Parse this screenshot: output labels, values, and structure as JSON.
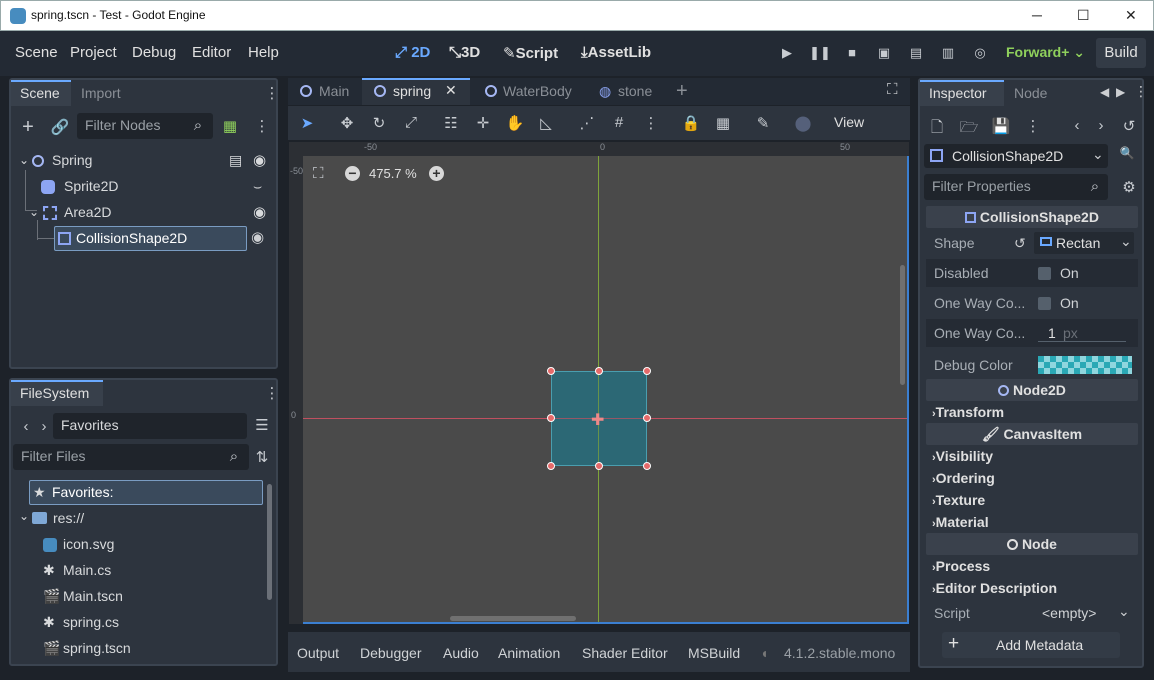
{
  "window": {
    "title": "spring.tscn - Test - Godot Engine",
    "min": "─",
    "max": "☐",
    "close": "✕"
  },
  "menu": [
    "Scene",
    "Project",
    "Debug",
    "Editor",
    "Help"
  ],
  "modes": {
    "m2d": "2D",
    "m3d": "3D",
    "script": "Script",
    "assetlib": "AssetLib"
  },
  "renderer": "Forward+",
  "build": "Build",
  "scene_dock": {
    "tabs": [
      "Scene",
      "Import"
    ],
    "filter_placeholder": "Filter Nodes",
    "nodes": [
      "Spring",
      "Sprite2D",
      "Area2D",
      "CollisionShape2D"
    ]
  },
  "filesystem": {
    "tab": "FileSystem",
    "path": "Favorites",
    "filter_placeholder": "Filter Files",
    "items": [
      "Favorites:",
      "res://",
      "icon.svg",
      "Main.cs",
      "Main.tscn",
      "spring.cs",
      "spring.tscn"
    ]
  },
  "editor_tabs": [
    "Main",
    "spring",
    "WaterBody",
    "stone"
  ],
  "toolbar": {
    "view": "View"
  },
  "viewport": {
    "zoom": "475.7 %",
    "ruler_top": [
      "-50",
      "0",
      "50"
    ],
    "ruler_left": [
      "-50",
      "0"
    ]
  },
  "inspector": {
    "tabs": [
      "Inspector",
      "Node"
    ],
    "node": "CollisionShape2D",
    "filter_placeholder": "Filter Properties",
    "section_collision": "CollisionShape2D",
    "shape_label": "Shape",
    "shape_value": "Rectan",
    "disabled_label": "Disabled",
    "disabled_value": "On",
    "oneway_label": "One Way Co...",
    "oneway_value": "On",
    "margin_label": "One Way Co...",
    "margin_value": "1",
    "margin_unit": "px",
    "debug_color_label": "Debug Color",
    "section_node2d": "Node2D",
    "transform": "Transform",
    "section_canvasitem": "CanvasItem",
    "visibility": "Visibility",
    "ordering": "Ordering",
    "texture": "Texture",
    "material": "Material",
    "section_node": "Node",
    "process": "Process",
    "editor_description": "Editor Description",
    "script_label": "Script",
    "script_value": "<empty>",
    "add_metadata": "Add Metadata"
  },
  "bottom_tabs": [
    "Output",
    "Debugger",
    "Audio",
    "Animation",
    "Shader Editor",
    "MSBuild"
  ],
  "version": "4.1.2.stable.mono",
  "colors": {
    "accent": "#6aa9ff",
    "renderer": "#8fd05c",
    "shape_fill": "#2b6a78",
    "handle": "#e56a6a"
  }
}
